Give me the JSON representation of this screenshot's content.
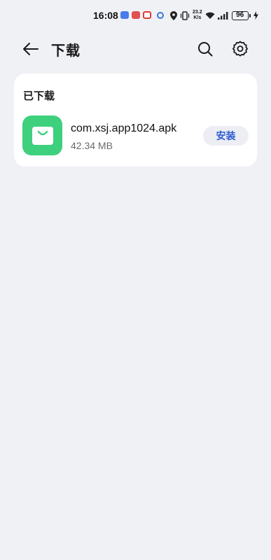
{
  "status_bar": {
    "time": "16:08",
    "network_speed_value": "23.2",
    "network_speed_unit": "K/s",
    "battery": "96"
  },
  "header": {
    "title": "下载",
    "back_icon": "arrow-left-icon",
    "search_icon": "search-icon",
    "settings_icon": "gear-icon"
  },
  "downloaded": {
    "section_title": "已下载",
    "items": [
      {
        "file_name": "com.xsj.app1024.apk",
        "file_size": "42.34 MB",
        "icon": "shopping-bag-icon",
        "action_label": "安装"
      }
    ]
  },
  "colors": {
    "background": "#f0f1f5",
    "app_icon": "#3ed07d",
    "install_text": "#2f5bd3",
    "install_bg": "#eceef3"
  }
}
